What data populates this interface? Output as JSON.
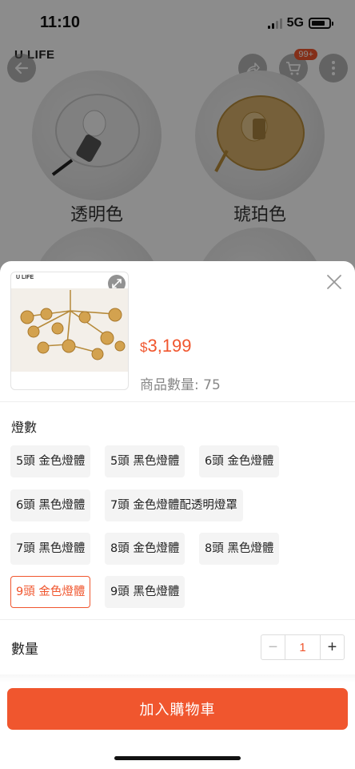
{
  "status_bar": {
    "time": "11:10",
    "network": "5G"
  },
  "header": {
    "brand": "U LIFE",
    "cart_badge": "99+"
  },
  "swatches": [
    {
      "label": "透明色"
    },
    {
      "label": "琥珀色"
    }
  ],
  "sheet": {
    "thumbnail_brand": "U LIFE",
    "price_currency": "$",
    "price_amount": "3,199",
    "stock_text": "商品數量: 75",
    "option_group_title": "燈數",
    "options": [
      {
        "label": "5頭 金色燈體",
        "selected": false
      },
      {
        "label": "5頭 黑色燈體",
        "selected": false
      },
      {
        "label": "6頭 金色燈體",
        "selected": false
      },
      {
        "label": "6頭 黑色燈體",
        "selected": false
      },
      {
        "label": "7頭 金色燈體配透明燈罩",
        "selected": false
      },
      {
        "label": "7頭 黑色燈體",
        "selected": false
      },
      {
        "label": "8頭 金色燈體",
        "selected": false
      },
      {
        "label": "8頭 黑色燈體",
        "selected": false
      },
      {
        "label": "9頭 金色燈體",
        "selected": true
      },
      {
        "label": "9頭 黑色燈體",
        "selected": false
      }
    ],
    "quantity_label": "數量",
    "quantity_value": "1",
    "minus_symbol": "−",
    "plus_symbol": "+",
    "add_to_cart_label": "加入購物車"
  },
  "colors": {
    "accent": "#f0562e"
  }
}
